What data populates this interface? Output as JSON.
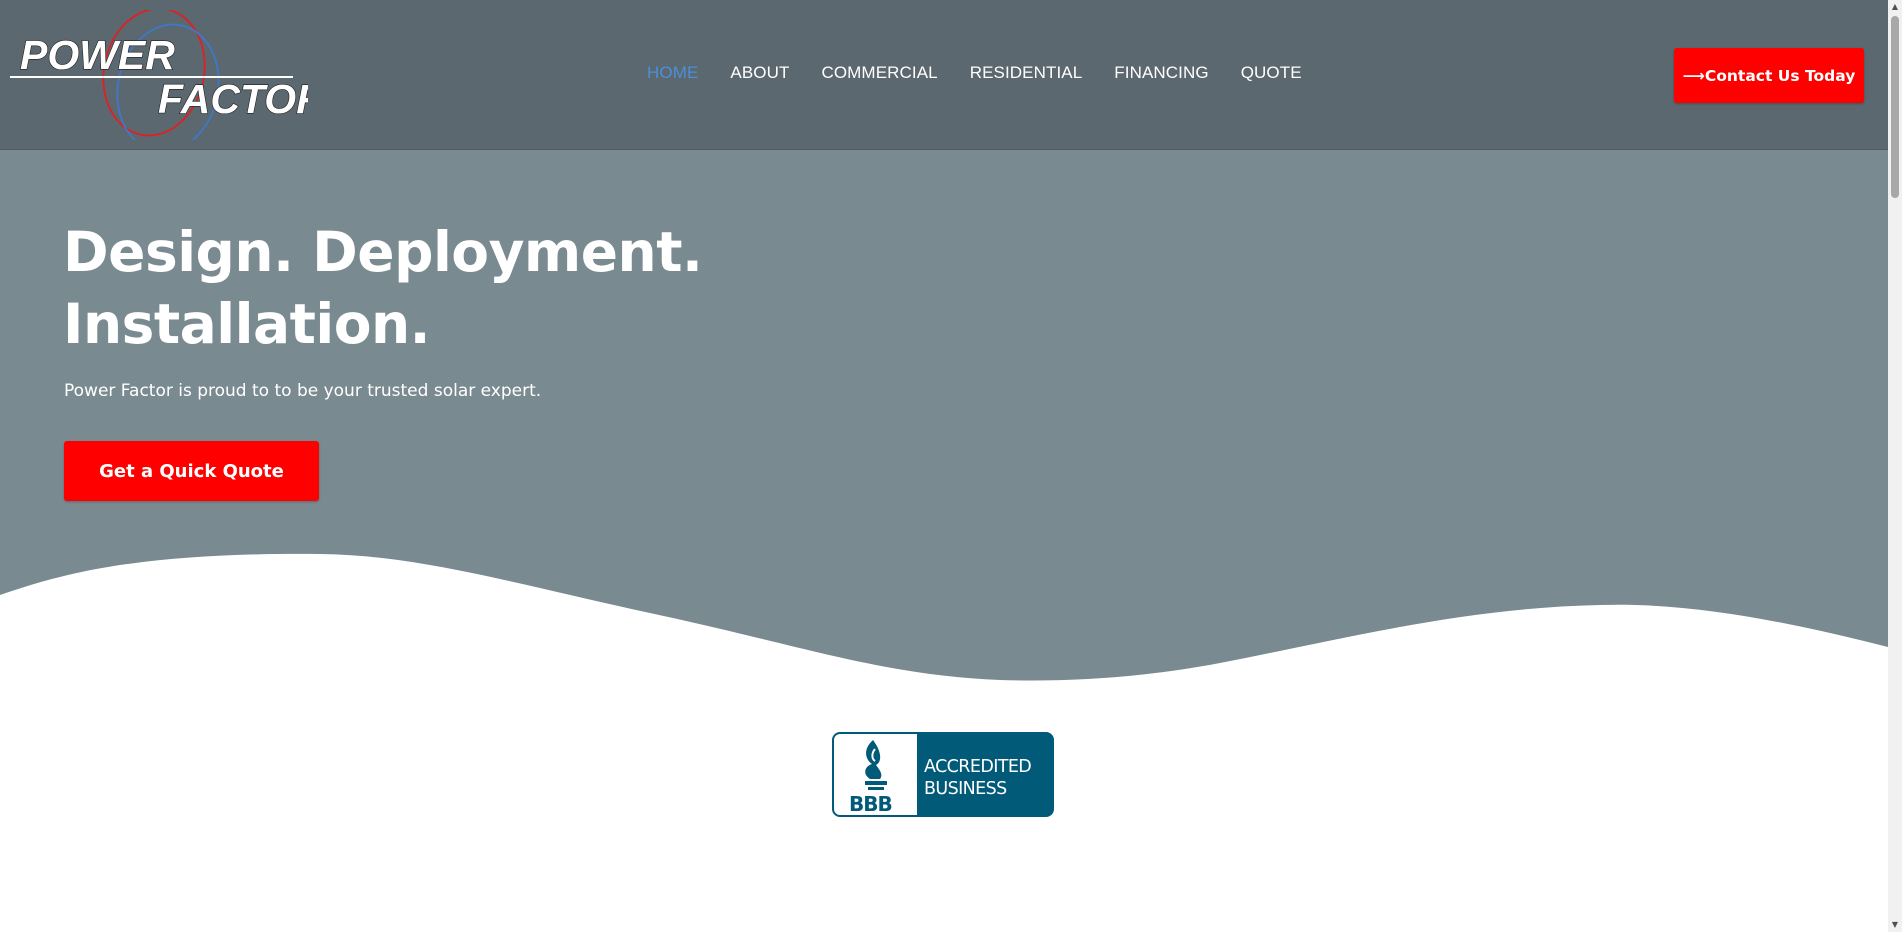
{
  "header": {
    "logo_text_line1": "POWER",
    "logo_text_line2": "FACTOR",
    "nav": [
      {
        "label": "HOME",
        "active": true
      },
      {
        "label": "ABOUT",
        "active": false
      },
      {
        "label": "COMMERCIAL",
        "active": false
      },
      {
        "label": "RESIDENTIAL",
        "active": false
      },
      {
        "label": "FINANCING",
        "active": false
      },
      {
        "label": "QUOTE",
        "active": false
      }
    ],
    "contact_icon": "arrow-right-icon",
    "contact_arrow": "⟶",
    "contact_label": "Contact Us Today"
  },
  "hero": {
    "title_line1": "Design. Deployment.",
    "title_line2": "Installation.",
    "subtitle": "Power Factor is proud to to be your trusted solar expert.",
    "cta_label": "Get a Quick Quote"
  },
  "badge": {
    "brand": "BBB",
    "line1": "ACCREDITED",
    "line2": "BUSINESS"
  },
  "colors": {
    "header_bg": "#5b6870",
    "hero_bg": "#7a8a91",
    "accent_red": "#ff0000",
    "nav_active": "#4a90d9",
    "bbb_blue": "#005a78"
  }
}
